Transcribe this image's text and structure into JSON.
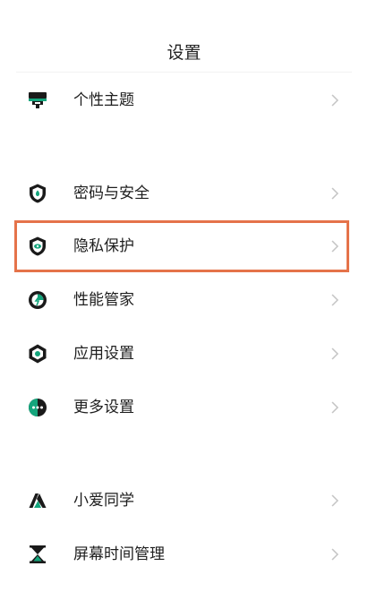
{
  "header": {
    "title": "设置"
  },
  "items": [
    {
      "label": "个性主题",
      "icon": "theme-icon"
    },
    {
      "label": "密码与安全",
      "icon": "lock-shield-icon"
    },
    {
      "label": "隐私保护",
      "icon": "privacy-shield-icon"
    },
    {
      "label": "性能管家",
      "icon": "performance-icon"
    },
    {
      "label": "应用设置",
      "icon": "app-settings-icon"
    },
    {
      "label": "更多设置",
      "icon": "more-settings-icon"
    },
    {
      "label": "小爱同学",
      "icon": "xiaoai-icon"
    },
    {
      "label": "屏幕时间管理",
      "icon": "hourglass-icon"
    }
  ],
  "colors": {
    "accent": "#14a57c",
    "text": "#1e1e1e",
    "chevron": "#c4c4c4",
    "highlight": "#e5734a"
  }
}
